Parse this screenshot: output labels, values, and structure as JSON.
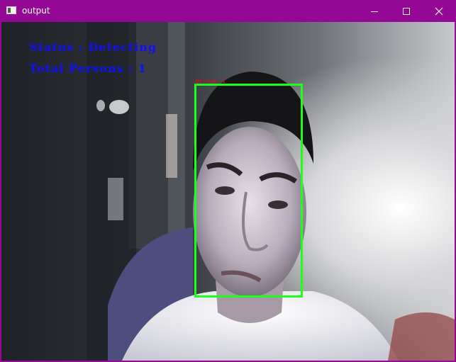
{
  "window": {
    "title": "output",
    "icon": "app-window-icon",
    "controls": [
      "minimize-icon",
      "maximize-icon",
      "close-icon"
    ]
  },
  "overlay": {
    "status": "Status : Detecting",
    "total": "Total Persons : 1",
    "detections": [
      {
        "label": "person 1",
        "color": "#1eff1e"
      }
    ],
    "text_color": "#1010ff",
    "label_color": "#e01010"
  },
  "colors": {
    "titlebar": "#950795",
    "frame": "#980898"
  }
}
